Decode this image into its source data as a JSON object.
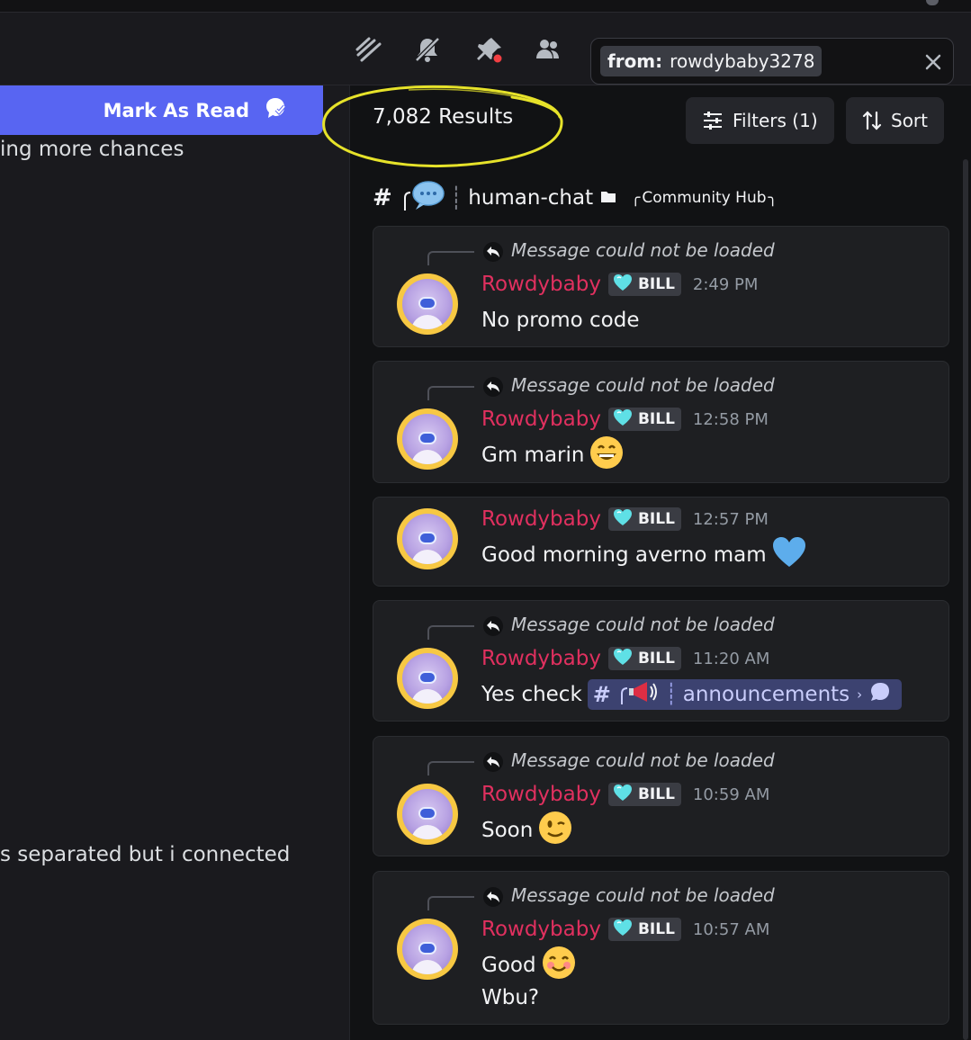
{
  "header": {
    "search": {
      "filter_key": "from:",
      "filter_value": "rowdybaby3278"
    },
    "icons": [
      "threads-icon",
      "mute-bell-icon",
      "pin-icon",
      "members-icon",
      "clear-search-icon"
    ]
  },
  "left_pane": {
    "mark_as_read_label": "Mark As Read",
    "line1": "ing more chances",
    "line2": "s separated but i connected"
  },
  "search_panel": {
    "results_count": "7,082 Results",
    "filters_label": "Filters (1)",
    "sort_label": "Sort",
    "channel": {
      "name": "human-chat",
      "category": "Community Hub"
    },
    "messages": [
      {
        "reply": "Message could not be loaded",
        "author": "Rowdybaby",
        "tag": "BILL",
        "time": "2:49 PM",
        "text": "No promo code"
      },
      {
        "reply": "Message could not be loaded",
        "author": "Rowdybaby",
        "tag": "BILL",
        "time": "12:58 PM",
        "text": "Gm marin",
        "emoji": "grinning-face"
      },
      {
        "author": "Rowdybaby",
        "tag": "BILL",
        "time": "12:57 PM",
        "text": "Good morning averno mam",
        "emoji": "blue-heart"
      },
      {
        "reply": "Message could not be loaded",
        "author": "Rowdybaby",
        "tag": "BILL",
        "time": "11:20 AM",
        "text": "Yes check",
        "mention_channel": "announcements"
      },
      {
        "reply": "Message could not be loaded",
        "author": "Rowdybaby",
        "tag": "BILL",
        "time": "10:59 AM",
        "text": "Soon",
        "emoji": "winking-face"
      },
      {
        "reply": "Message could not be loaded",
        "author": "Rowdybaby",
        "tag": "BILL",
        "time": "10:57 AM",
        "text": "Good",
        "text2": "Wbu?",
        "emoji": "smiling-face"
      }
    ]
  },
  "colors": {
    "accent": "#5865f2",
    "author_name": "#e0305f",
    "annotation": "#e6e22a"
  }
}
